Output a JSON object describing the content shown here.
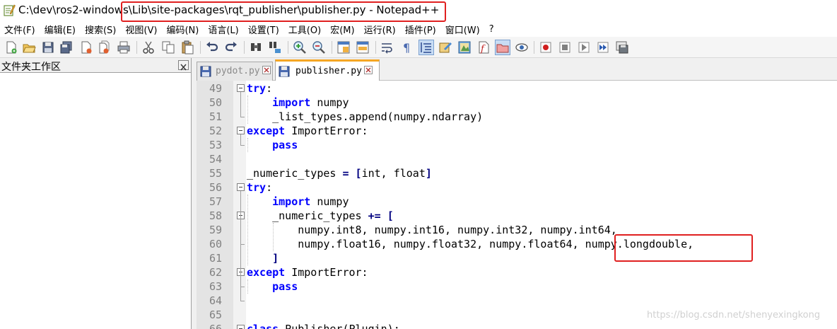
{
  "window": {
    "title": "C:\\dev\\ros2-windows\\Lib\\site-packages\\rqt_publisher\\publisher.py - Notepad++"
  },
  "menu": {
    "items": [
      "文件(F)",
      "编辑(E)",
      "搜索(S)",
      "视图(V)",
      "编码(N)",
      "语言(L)",
      "设置(T)",
      "工具(O)",
      "宏(M)",
      "运行(R)",
      "插件(P)",
      "窗口(W)",
      "?"
    ]
  },
  "toolbar": {
    "icons": [
      "new-file-icon",
      "open-file-icon",
      "save-icon",
      "save-all-icon",
      "close-icon",
      "close-all-icon",
      "print-icon",
      "cut-icon",
      "copy-icon",
      "paste-icon",
      "undo-icon",
      "redo-icon",
      "find-icon",
      "replace-icon",
      "zoom-in-icon",
      "zoom-out-icon",
      "sync-vertical-icon",
      "sync-horizontal-icon",
      "word-wrap-icon",
      "show-all-chars-icon",
      "indent-guide-icon",
      "user-language-icon",
      "document-map-icon",
      "function-list-icon",
      "folder-workspace-icon",
      "monitoring-icon",
      "record-macro-icon",
      "stop-record-icon",
      "play-macro-icon",
      "run-macro-multiple-icon",
      "save-macro-icon"
    ]
  },
  "folder_panel": {
    "title": "文件夹工作区"
  },
  "tabs": [
    {
      "label": "pydot.py",
      "active": false
    },
    {
      "label": "publisher.py",
      "active": true
    }
  ],
  "editor": {
    "lines": [
      {
        "n": "49",
        "text": "try:"
      },
      {
        "n": "50",
        "text": "    import numpy"
      },
      {
        "n": "51",
        "text": "    _list_types.append(numpy.ndarray)"
      },
      {
        "n": "52",
        "text": "except ImportError:"
      },
      {
        "n": "53",
        "text": "    pass"
      },
      {
        "n": "54",
        "text": ""
      },
      {
        "n": "55",
        "text": "_numeric_types = [int, float]"
      },
      {
        "n": "56",
        "text": "try:"
      },
      {
        "n": "57",
        "text": "    import numpy"
      },
      {
        "n": "58",
        "text": "    _numeric_types += ["
      },
      {
        "n": "59",
        "text": "        numpy.int8, numpy.int16, numpy.int32, numpy.int64,"
      },
      {
        "n": "60",
        "text": "        numpy.float16, numpy.float32, numpy.float64, numpy.longdouble,"
      },
      {
        "n": "61",
        "text": "    ]"
      },
      {
        "n": "62",
        "text": "except ImportError:"
      },
      {
        "n": "63",
        "text": "    pass"
      },
      {
        "n": "64",
        "text": ""
      },
      {
        "n": "65",
        "text": ""
      },
      {
        "n": "66",
        "text": "class Publisher(Plugin):"
      }
    ]
  },
  "watermark": "https://blog.csdn.net/shenyexingkong",
  "colors": {
    "highlight_box": "#e02020",
    "keyword": "#0000ff",
    "active_tab_accent": "#f5a623"
  }
}
